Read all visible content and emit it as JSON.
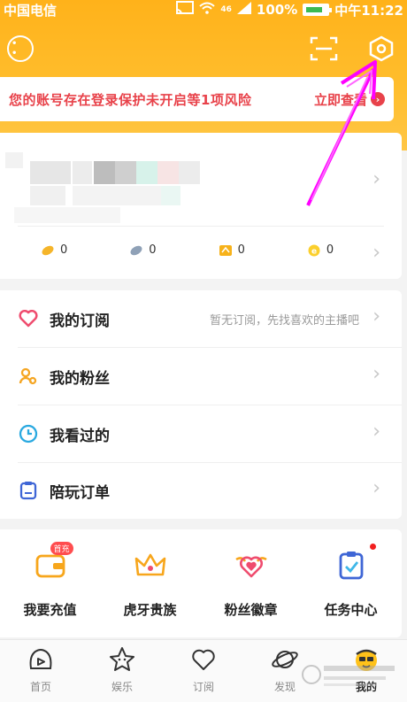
{
  "status_bar": {
    "carrier": "中国电信",
    "signal_text": "46",
    "battery": "100%",
    "time": "中午11:22"
  },
  "risk_banner": {
    "message": "您的账号存在登录保护未开启等1项风险",
    "action": "立即查看"
  },
  "profile": {
    "stats": [
      {
        "icon": "gold-bean-icon",
        "value": "0"
      },
      {
        "icon": "silver-bean-icon",
        "value": "0"
      },
      {
        "icon": "coupon-icon",
        "value": "0"
      },
      {
        "icon": "e-coin-icon",
        "value": "0"
      }
    ]
  },
  "menu": [
    {
      "icon": "heart-icon",
      "label": "我的订阅",
      "hint": "暂无订阅，先找喜欢的主播吧"
    },
    {
      "icon": "fans-icon",
      "label": "我的粉丝",
      "hint": ""
    },
    {
      "icon": "clock-icon",
      "label": "我看过的",
      "hint": ""
    },
    {
      "icon": "order-icon",
      "label": "陪玩订单",
      "hint": ""
    }
  ],
  "grid": [
    {
      "icon": "wallet-icon",
      "label": "我要充值",
      "badge": "首充"
    },
    {
      "icon": "crown-icon",
      "label": "虎牙贵族"
    },
    {
      "icon": "fan-badge-icon",
      "label": "粉丝徽章"
    },
    {
      "icon": "task-icon",
      "label": "任务中心"
    }
  ],
  "tabs": [
    {
      "icon": "home-icon",
      "label": "首页"
    },
    {
      "icon": "star-icon",
      "label": "娱乐"
    },
    {
      "icon": "subscribe-heart-icon",
      "label": "订阅"
    },
    {
      "icon": "planet-icon",
      "label": "发现"
    },
    {
      "icon": "me-avatar-icon",
      "label": "我的"
    }
  ],
  "colors": {
    "header": "#ffb21a",
    "risk": "#e8424a",
    "annotation": "#ff00ff"
  }
}
